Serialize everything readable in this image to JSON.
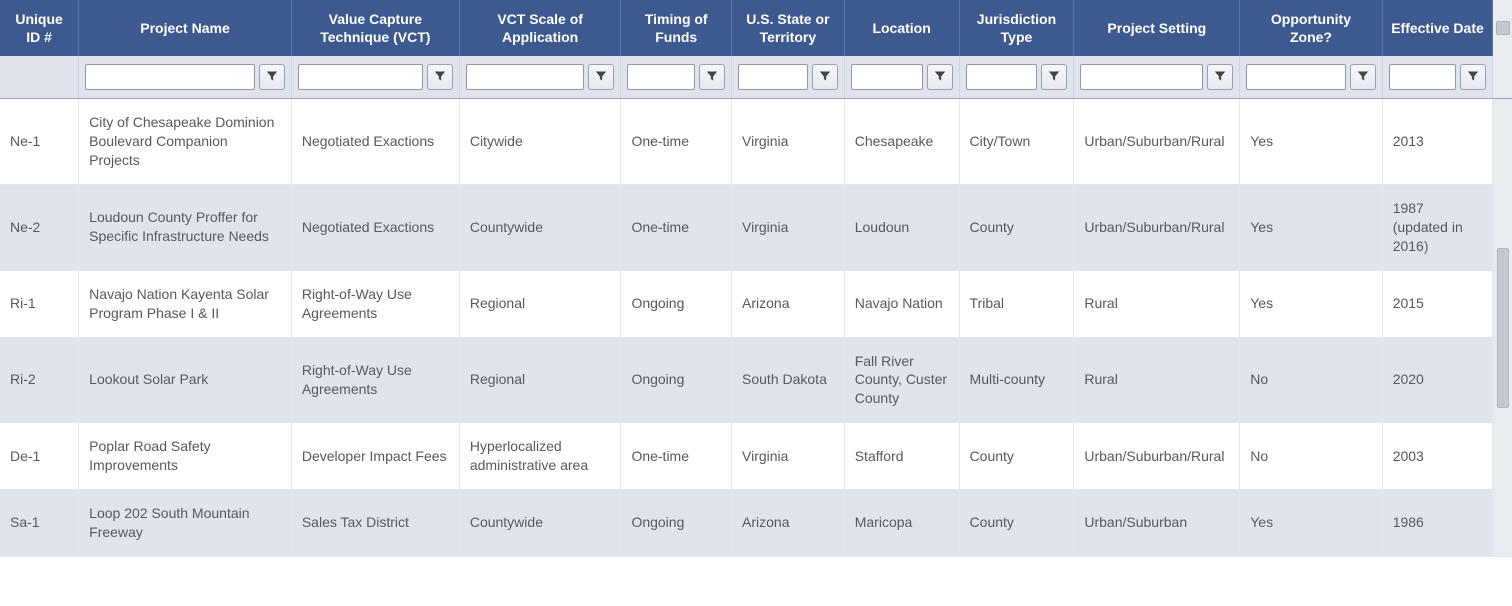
{
  "columns": [
    {
      "key": "uid",
      "label": "Unique ID #",
      "hasFilter": false
    },
    {
      "key": "name",
      "label": "Project Name",
      "hasFilter": true
    },
    {
      "key": "vct",
      "label": "Value Capture Technique (VCT)",
      "hasFilter": true
    },
    {
      "key": "scale",
      "label": "VCT Scale of Application",
      "hasFilter": true
    },
    {
      "key": "timing",
      "label": "Timing of Funds",
      "hasFilter": true
    },
    {
      "key": "state",
      "label": "U.S. State or Territory",
      "hasFilter": true
    },
    {
      "key": "loc",
      "label": "Location",
      "hasFilter": true
    },
    {
      "key": "jur",
      "label": "Jurisdiction Type",
      "hasFilter": true
    },
    {
      "key": "setting",
      "label": "Project Setting",
      "hasFilter": true
    },
    {
      "key": "oz",
      "label": "Opportunity Zone?",
      "hasFilter": true
    },
    {
      "key": "eff",
      "label": "Effective Date",
      "hasFilter": true
    }
  ],
  "rows": [
    {
      "uid": "Ne-1",
      "name": "City of Chesapeake Dominion Boulevard Companion Projects",
      "vct": "Negotiated Exactions",
      "scale": "Citywide",
      "timing": "One-time",
      "state": "Virginia",
      "loc": "Chesapeake",
      "jur": "City/Town",
      "setting": "Urban/Suburban/Rural",
      "oz": "Yes",
      "eff": "2013"
    },
    {
      "uid": "Ne-2",
      "name": "Loudoun County Proffer for Specific Infrastructure Needs",
      "vct": "Negotiated Exactions",
      "scale": "Countywide",
      "timing": "One-time",
      "state": "Virginia",
      "loc": "Loudoun",
      "jur": "County",
      "setting": "Urban/Suburban/Rural",
      "oz": "Yes",
      "eff": "1987 (updated in 2016)"
    },
    {
      "uid": "Ri-1",
      "name": "Navajo Nation Kayenta Solar Program Phase I & II",
      "vct": "Right-of-Way Use Agreements",
      "scale": "Regional",
      "timing": "Ongoing",
      "state": "Arizona",
      "loc": "Navajo Nation",
      "jur": "Tribal",
      "setting": "Rural",
      "oz": "Yes",
      "eff": "2015"
    },
    {
      "uid": "Ri-2",
      "name": "Lookout Solar Park",
      "vct": "Right-of-Way Use Agreements",
      "scale": "Regional",
      "timing": "Ongoing",
      "state": "South Dakota",
      "loc": "Fall River County, Custer County",
      "jur": "Multi-county",
      "setting": "Rural",
      "oz": "No",
      "eff": "2020"
    },
    {
      "uid": "De-1",
      "name": "Poplar Road Safety Improvements",
      "vct": "Developer Impact Fees",
      "scale": "Hyperlocalized administrative area",
      "timing": "One-time",
      "state": "Virginia",
      "loc": "Stafford",
      "jur": "County",
      "setting": "Urban/Suburban/Rural",
      "oz": "No",
      "eff": "2003"
    },
    {
      "uid": "Sa-1",
      "name": "Loop 202 South Mountain Freeway",
      "vct": "Sales Tax District",
      "scale": "Countywide",
      "timing": "Ongoing",
      "state": "Arizona",
      "loc": "Maricopa",
      "jur": "County",
      "setting": "Urban/Suburban",
      "oz": "Yes",
      "eff": "1986"
    }
  ],
  "filterPlaceholder": ""
}
